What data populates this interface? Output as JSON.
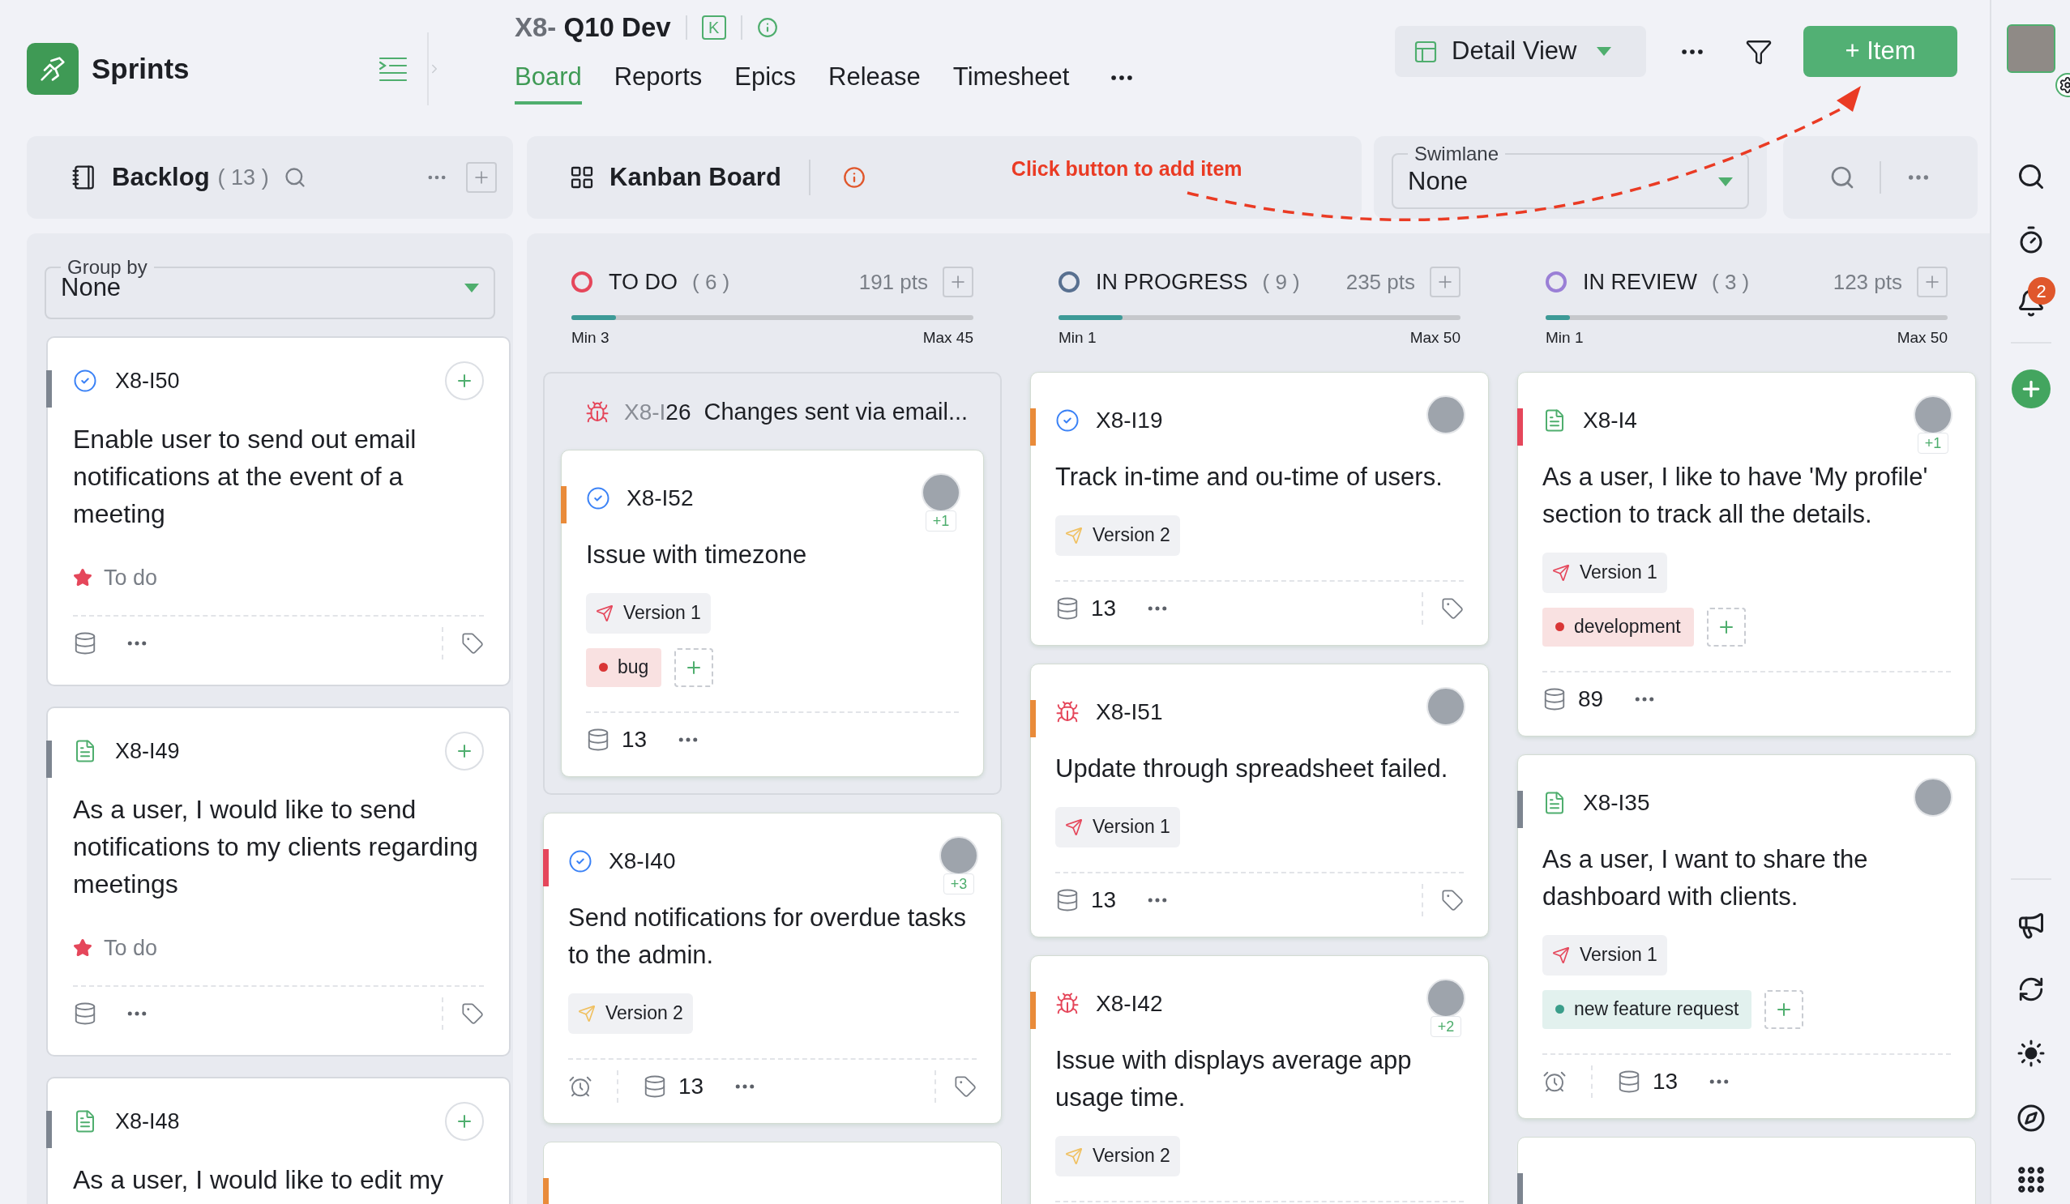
{
  "app": {
    "name": "Sprints"
  },
  "sprint": {
    "prefix": "X8-",
    "name": "Q10 Dev",
    "key_badge": "K"
  },
  "tabs": [
    {
      "label": "Board",
      "selected": true
    },
    {
      "label": "Reports",
      "selected": false
    },
    {
      "label": "Epics",
      "selected": false
    },
    {
      "label": "Release",
      "selected": false
    },
    {
      "label": "Timesheet",
      "selected": false
    }
  ],
  "view_select": {
    "value": "Detail View"
  },
  "add_button": {
    "label": "+ Item"
  },
  "backlog": {
    "title": "Backlog",
    "count": "( 13 )",
    "group_by": {
      "label": "Group by",
      "value": "None"
    },
    "cards": [
      {
        "id": "X8-I50",
        "kind": "task",
        "color": "#7d8590",
        "title": "Enable user to send out email notifications at the event of a meeting",
        "status": "To do"
      },
      {
        "id": "X8-I49",
        "kind": "story",
        "color": "#7d8590",
        "title": "As a user, I would like to send notifications to my clients regarding meetings",
        "status": "To do"
      },
      {
        "id": "X8-I48",
        "kind": "story",
        "color": "#7d8590",
        "title": "As a user, I would like to edit my"
      }
    ]
  },
  "kanban": {
    "title": "Kanban Board",
    "annotation": "Click button to add item"
  },
  "swimlane": {
    "label": "Swimlane",
    "value": "None"
  },
  "columns": [
    {
      "name": "TO DO",
      "count": "( 6 )",
      "points": "191 pts",
      "color": "#e5475b",
      "level": 0.11,
      "min": "Min 3",
      "max": "Max 45",
      "items": [
        {
          "kind": "bug",
          "id_prefix": "X8-I",
          "id_number": "26",
          "title": "Changes sent via email...",
          "children": [
            {
              "kind": "task",
              "id": "X8-I52",
              "color": "#e98b3a",
              "avatar": true,
              "extra": "+1",
              "title": "Issue with timezone",
              "release": {
                "label": "Version 1",
                "color": "#e5475b"
              },
              "tags": [
                {
                  "label": "bug",
                  "color": "#d93636"
                }
              ],
              "timer": false,
              "points": "13"
            }
          ]
        },
        {
          "kind": "task",
          "id": "X8-I40",
          "color": "#e5475b",
          "avatar": true,
          "extra": "+3",
          "title": "Send notifications for overdue tasks to the admin.",
          "release": {
            "label": "Version 2",
            "color": "#f0c060"
          },
          "timer": true,
          "points": "13"
        },
        {
          "kind": "stub",
          "color": "#e98b3a"
        }
      ]
    },
    {
      "name": "IN PROGRESS",
      "count": "( 9 )",
      "points": "235 pts",
      "color": "#587090",
      "level": 0.16,
      "min": "Min 1",
      "max": "Max 50",
      "items": [
        {
          "kind": "task",
          "id": "X8-I19",
          "color": "#e98b3a",
          "avatar": true,
          "title": "Track in-time and ou-time of users.",
          "release": {
            "label": "Version 2",
            "color": "#f0c060"
          },
          "timer": false,
          "points": "13"
        },
        {
          "kind": "bug",
          "id": "X8-I51",
          "color": "#e98b3a",
          "avatar": true,
          "title": "Update through spreadsheet failed.",
          "release": {
            "label": "Version 1",
            "color": "#e5475b"
          },
          "timer": false,
          "points": "13"
        },
        {
          "kind": "bug",
          "id": "X8-I42",
          "color": "#e98b3a",
          "avatar": true,
          "extra": "+2",
          "title": "Issue with displays average app usage time.",
          "release": {
            "label": "Version 2",
            "color": "#f0c060"
          }
        }
      ]
    },
    {
      "name": "IN REVIEW",
      "count": "( 3 )",
      "points": "123 pts",
      "color": "#9a7fd6",
      "level": 0.06,
      "min": "Min 1",
      "max": "Max 50",
      "items": [
        {
          "kind": "story",
          "id": "X8-I4",
          "color": "#e5475b",
          "avatar": true,
          "extra": "+1",
          "title": "As a user, I like to have 'My profile' section to track all the details.",
          "release": {
            "label": "Version 1",
            "color": "#e5475b"
          },
          "tags": [
            {
              "label": "development",
              "color": "#d93636"
            }
          ],
          "timer": false,
          "points": "89"
        },
        {
          "kind": "story",
          "id": "X8-I35",
          "color": "#7d8590",
          "avatar": true,
          "title": "As a user, I want to share the dashboard with clients.",
          "release": {
            "label": "Version 1",
            "color": "#e5475b"
          },
          "tags": [
            {
              "label": "new feature request",
              "color": "#3a9e8a"
            }
          ],
          "timer": true,
          "points": "13"
        },
        {
          "kind": "stub",
          "color": "#7d8590"
        }
      ]
    }
  ],
  "sidebar": {
    "notifications": "2"
  }
}
